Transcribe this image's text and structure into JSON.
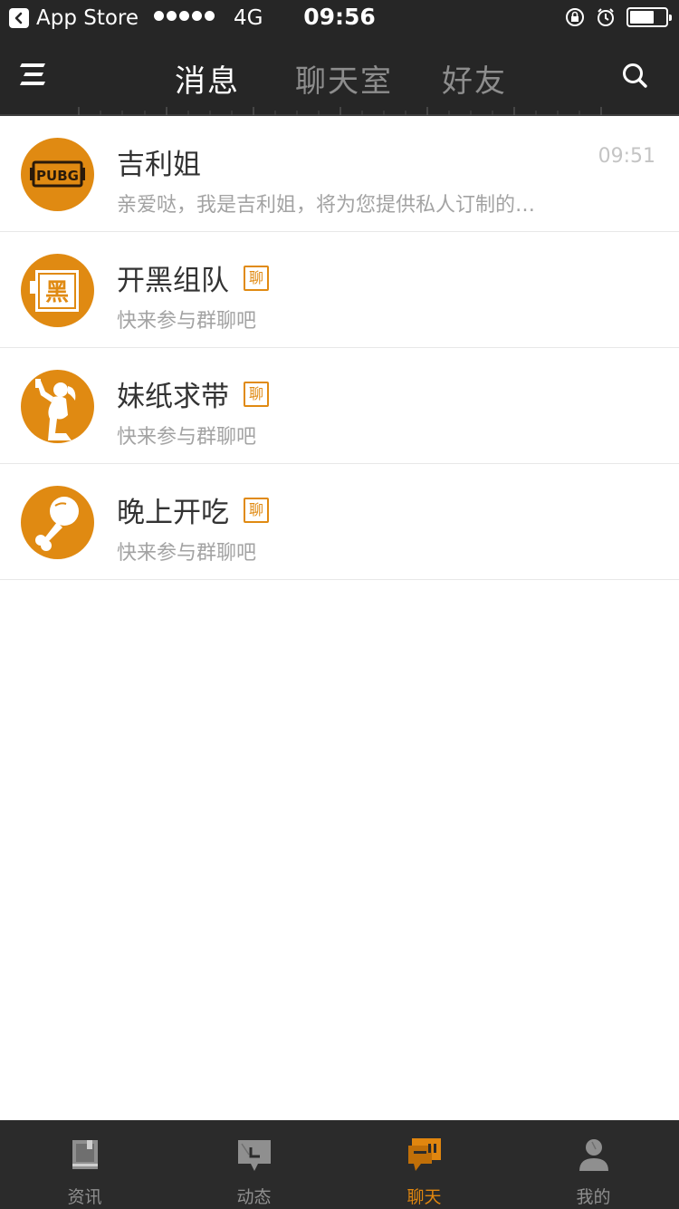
{
  "status_bar": {
    "back_app": "App Store",
    "network": "4G",
    "time": "09:56"
  },
  "header": {
    "tabs": [
      {
        "label": "消息",
        "active": true
      },
      {
        "label": "聊天室",
        "active": false
      },
      {
        "label": "好友",
        "active": false
      }
    ],
    "menu_icon": "menu-icon",
    "search_icon": "search-icon"
  },
  "chats": [
    {
      "name": "吉利姐",
      "preview": "亲爱哒，我是吉利姐，将为您提供私人订制的…",
      "time": "09:51",
      "is_group": false,
      "avatar_icon": "pubg-logo"
    },
    {
      "name": "开黑组队",
      "preview": "快来参与群聊吧",
      "time": "",
      "is_group": true,
      "group_tag": "聊",
      "avatar_icon": "black-sign-icon"
    },
    {
      "name": "妹纸求带",
      "preview": "快来参与群聊吧",
      "time": "",
      "is_group": true,
      "group_tag": "聊",
      "avatar_icon": "girl-with-gun-icon"
    },
    {
      "name": "晚上开吃",
      "preview": "快来参与群聊吧",
      "time": "",
      "is_group": true,
      "group_tag": "聊",
      "avatar_icon": "drumstick-icon"
    }
  ],
  "tabbar": [
    {
      "label": "资讯",
      "icon": "news-icon",
      "active": false
    },
    {
      "label": "动态",
      "icon": "moments-icon",
      "active": false
    },
    {
      "label": "聊天",
      "icon": "chat-icon",
      "active": true
    },
    {
      "label": "我的",
      "icon": "profile-icon",
      "active": false
    }
  ],
  "colors": {
    "accent": "#e0860f",
    "header_bg": "#262626",
    "tabbar_bg": "#2b2b2b"
  }
}
